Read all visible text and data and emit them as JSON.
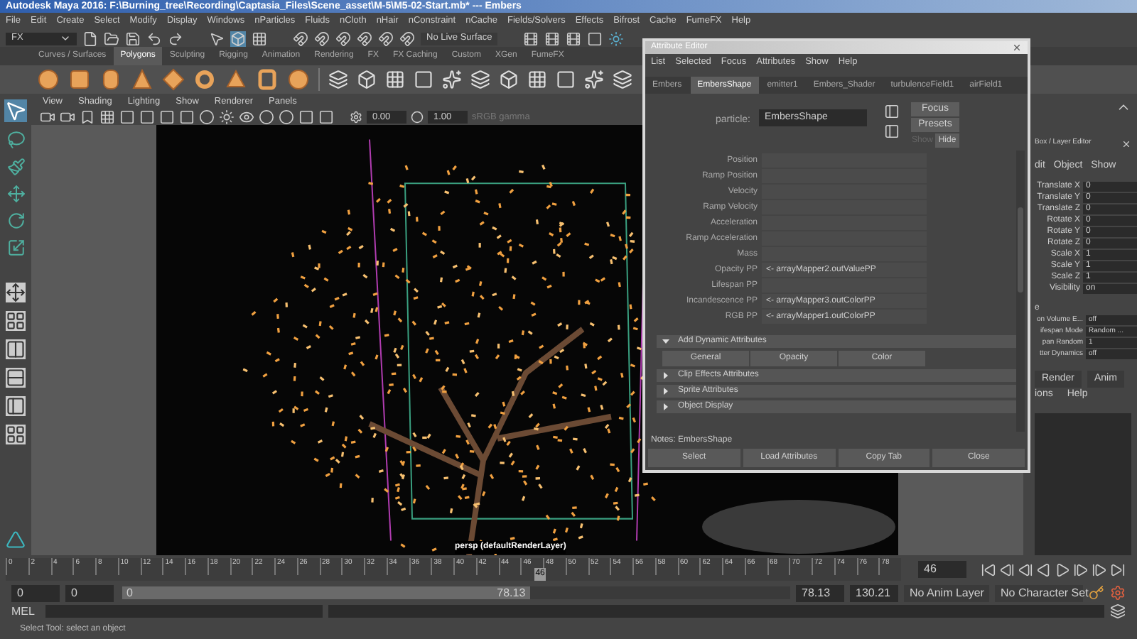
{
  "window": {
    "title": "Autodesk Maya 2016: F:\\Burning_tree\\Recording\\Captasia_Files\\Scene_asset\\M-5\\M5-02-Start.mb*  ---  Embers"
  },
  "menu": [
    "File",
    "Edit",
    "Create",
    "Select",
    "Modify",
    "Display",
    "Windows",
    "nParticles",
    "Fluids",
    "nCloth",
    "nHair",
    "nConstraint",
    "nCache",
    "Fields/Solvers",
    "Effects",
    "Bifrost",
    "Cache",
    "FumeFX",
    "Help"
  ],
  "status_line": {
    "menuset": "FX",
    "live_surface": "No Live Surface"
  },
  "shelf": {
    "tabs": [
      {
        "label": "Curves / Surfaces",
        "selected": false
      },
      {
        "label": "Polygons",
        "selected": true
      },
      {
        "label": "Sculpting",
        "selected": false
      },
      {
        "label": "Rigging",
        "selected": false
      },
      {
        "label": "Animation",
        "selected": false
      },
      {
        "label": "Rendering",
        "selected": false
      },
      {
        "label": "FX",
        "selected": false
      },
      {
        "label": "FX Caching",
        "selected": false
      },
      {
        "label": "Custom",
        "selected": false
      },
      {
        "label": "XGen",
        "selected": false
      },
      {
        "label": "FumeFX",
        "selected": false
      }
    ]
  },
  "viewport": {
    "menu": [
      "View",
      "Shading",
      "Lighting",
      "Show",
      "Renderer",
      "Panels"
    ],
    "exposure": "0.00",
    "gamma": "1.00",
    "color_space": "sRGB gamma",
    "camera_label": "persp (defaultRenderLayer)"
  },
  "attribute_editor": {
    "title": "Attribute Editor",
    "menu": [
      "List",
      "Selected",
      "Focus",
      "Attributes",
      "Show",
      "Help"
    ],
    "tabs": [
      {
        "label": "Embers",
        "selected": false
      },
      {
        "label": "EmbersShape",
        "selected": true
      },
      {
        "label": "emitter1",
        "selected": false
      },
      {
        "label": "Embers_Shader",
        "selected": false
      },
      {
        "label": "turbulenceField1",
        "selected": false
      },
      {
        "label": "airField1",
        "selected": false
      }
    ],
    "particle_label": "particle:",
    "particle_value": "EmbersShape",
    "focus": "Focus",
    "presets": "Presets",
    "show": "Show",
    "hide": "Hide",
    "attributes": [
      {
        "label": "Position"
      },
      {
        "label": "Ramp Position"
      },
      {
        "label": "Velocity"
      },
      {
        "label": "Ramp Velocity"
      },
      {
        "label": "Acceleration"
      },
      {
        "label": "Ramp Acceleration"
      },
      {
        "label": "Mass"
      },
      {
        "label": "Opacity PP",
        "value": "<- arrayMapper2.outValuePP"
      },
      {
        "label": "Lifespan PP"
      },
      {
        "label": "Incandescence PP",
        "value": "<- arrayMapper3.outColorPP"
      },
      {
        "label": "RGB PP",
        "value": "<- arrayMapper1.outColorPP"
      }
    ],
    "sections": [
      {
        "label": "Add Dynamic Attributes",
        "expanded": true,
        "buttons": [
          "General",
          "Opacity",
          "Color"
        ]
      },
      {
        "label": "Clip Effects Attributes",
        "expanded": false
      },
      {
        "label": "Sprite Attributes",
        "expanded": false
      },
      {
        "label": "Object Display",
        "expanded": false
      }
    ],
    "notes": "Notes:  EmbersShape",
    "buttons": [
      "Select",
      "Load Attributes",
      "Copy Tab",
      "Close"
    ]
  },
  "channel_box": {
    "title": "Box / Layer Editor",
    "menu": [
      "dit",
      "Object",
      "Show"
    ],
    "channels": [
      {
        "name": "Translate X",
        "value": "0"
      },
      {
        "name": "Translate Y",
        "value": "0"
      },
      {
        "name": "Translate Z",
        "value": "0"
      },
      {
        "name": "Rotate X",
        "value": "0"
      },
      {
        "name": "Rotate Y",
        "value": "0"
      },
      {
        "name": "Rotate Z",
        "value": "0"
      },
      {
        "name": "Scale X",
        "value": "1"
      },
      {
        "name": "Scale Y",
        "value": "1"
      },
      {
        "name": "Scale Z",
        "value": "1"
      },
      {
        "name": "Visibility",
        "value": "on"
      }
    ],
    "shape_header": "e",
    "shape_channels": [
      {
        "name": "on Volume E...",
        "value": "off"
      },
      {
        "name": "ifespan Mode",
        "value": "Random ..."
      },
      {
        "name": "pan Random",
        "value": "1"
      },
      {
        "name": "tter Dynamics",
        "value": "off"
      }
    ],
    "layer_tabs": [
      {
        "label": "Render",
        "selected": false
      },
      {
        "label": "Anim",
        "selected": false
      }
    ],
    "layer_menu": [
      "ions",
      "Help"
    ]
  },
  "timeline": {
    "ticks": [
      "0",
      "2",
      "4",
      "6",
      "8",
      "10",
      "12",
      "14",
      "16",
      "18",
      "20",
      "22",
      "24",
      "26",
      "28",
      "30",
      "32",
      "34",
      "36",
      "38",
      "40",
      "42",
      "44",
      "46",
      "48",
      "50",
      "52",
      "54",
      "56",
      "58",
      "60",
      "62",
      "64",
      "66",
      "68",
      "70",
      "72",
      "74",
      "76",
      "78"
    ],
    "playhead": {
      "label": "46",
      "level": 0.59
    },
    "current_frame": "46"
  },
  "range": {
    "level": 0.61,
    "start": "0",
    "inner_start": "0",
    "slider_start": "0",
    "slider_end": "78.13",
    "inner_end": "78.13",
    "end": "130.21",
    "anim_layer": "No Anim Layer",
    "character_set": "No Character Set"
  },
  "command_line": {
    "label": "MEL"
  },
  "help_line": "Select Tool: select an object"
}
